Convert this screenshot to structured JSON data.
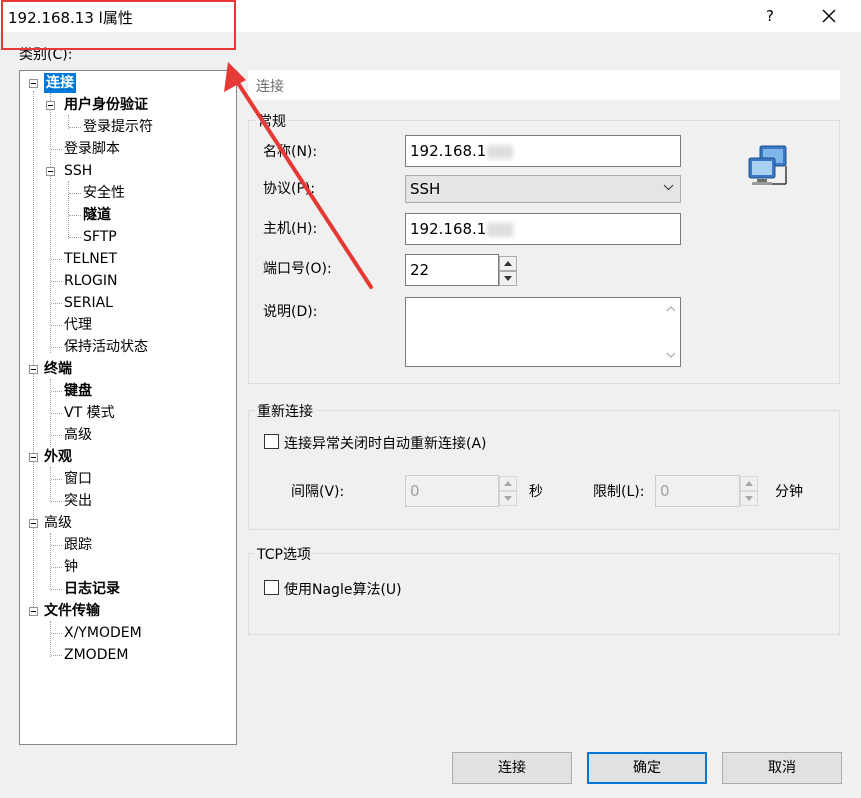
{
  "window": {
    "title": "192.168.13 l属性",
    "help": "?",
    "close_icon": "close-icon"
  },
  "category_label": "类别(C):",
  "tree": [
    {
      "label": "连接",
      "bold": true,
      "selected": true,
      "level": 0,
      "expander": true
    },
    {
      "label": "用户身份验证",
      "bold": true,
      "level": 1,
      "expander": true
    },
    {
      "label": "登录提示符",
      "bold": false,
      "level": 2
    },
    {
      "label": "登录脚本",
      "bold": false,
      "level": 1
    },
    {
      "label": "SSH",
      "bold": false,
      "level": 1,
      "expander": true
    },
    {
      "label": "安全性",
      "bold": false,
      "level": 2
    },
    {
      "label": "隧道",
      "bold": true,
      "level": 2
    },
    {
      "label": "SFTP",
      "bold": false,
      "level": 2
    },
    {
      "label": "TELNET",
      "bold": false,
      "level": 1
    },
    {
      "label": "RLOGIN",
      "bold": false,
      "level": 1
    },
    {
      "label": "SERIAL",
      "bold": false,
      "level": 1
    },
    {
      "label": "代理",
      "bold": false,
      "level": 1
    },
    {
      "label": "保持活动状态",
      "bold": false,
      "level": 1
    },
    {
      "label": "终端",
      "bold": true,
      "level": 0,
      "expander": true
    },
    {
      "label": "键盘",
      "bold": true,
      "level": 1
    },
    {
      "label": "VT 模式",
      "bold": false,
      "level": 1
    },
    {
      "label": "高级",
      "bold": false,
      "level": 1
    },
    {
      "label": "外观",
      "bold": true,
      "level": 0,
      "expander": true
    },
    {
      "label": "窗口",
      "bold": false,
      "level": 1
    },
    {
      "label": "突出",
      "bold": false,
      "level": 1
    },
    {
      "label": "高级",
      "bold": false,
      "level": 0,
      "expander": true
    },
    {
      "label": "跟踪",
      "bold": false,
      "level": 1
    },
    {
      "label": "钟",
      "bold": false,
      "level": 1
    },
    {
      "label": "日志记录",
      "bold": true,
      "level": 1
    },
    {
      "label": "文件传输",
      "bold": true,
      "level": 0,
      "expander": true
    },
    {
      "label": "X/YMODEM",
      "bold": false,
      "level": 1
    },
    {
      "label": "ZMODEM",
      "bold": false,
      "level": 1
    }
  ],
  "section_header": "连接",
  "general": {
    "title": "常规",
    "name_label": "名称(N):",
    "name_value": "192.168.1",
    "protocol_label": "协议(P):",
    "protocol_value": "SSH",
    "host_label": "主机(H):",
    "host_value": "192.168.1",
    "port_label": "端口号(O):",
    "port_value": "22",
    "desc_label": "说明(D):",
    "desc_value": ""
  },
  "reconnect": {
    "title": "重新连接",
    "checkbox_label": "连接异常关闭时自动重新连接(A)",
    "interval_label": "间隔(V):",
    "interval_value": "0",
    "interval_unit": "秒",
    "limit_label": "限制(L):",
    "limit_value": "0",
    "limit_unit": "分钟"
  },
  "tcp": {
    "title": "TCP选项",
    "checkbox_label": "使用Nagle算法(U)"
  },
  "buttons": {
    "connect": "连接",
    "ok": "确定",
    "cancel": "取消"
  },
  "annotation_color": "#e53935",
  "accent_color": "#0078d7"
}
